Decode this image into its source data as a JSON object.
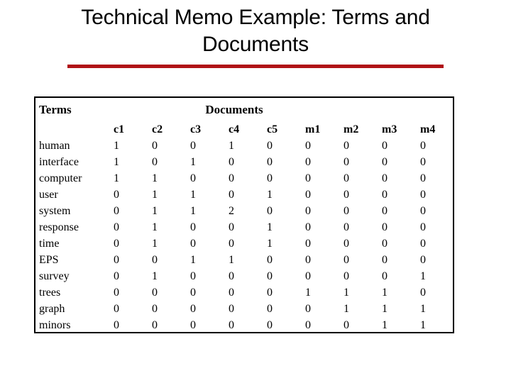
{
  "slide": {
    "title": "Technical Memo Example: Terms and Documents",
    "accent_color": "#b01217",
    "border_color": "#000000",
    "background_color": "#ffffff"
  },
  "table": {
    "section_headers": {
      "terms": "Terms",
      "documents": "Documents"
    },
    "row_label_header": "",
    "columns": [
      "c1",
      "c2",
      "c3",
      "c4",
      "c5",
      "m1",
      "m2",
      "m3",
      "m4"
    ],
    "rows": [
      {
        "term": "human",
        "values": [
          1,
          0,
          0,
          1,
          0,
          0,
          0,
          0,
          0
        ]
      },
      {
        "term": "interface",
        "values": [
          1,
          0,
          1,
          0,
          0,
          0,
          0,
          0,
          0
        ]
      },
      {
        "term": "computer",
        "values": [
          1,
          1,
          0,
          0,
          0,
          0,
          0,
          0,
          0
        ]
      },
      {
        "term": "user",
        "values": [
          0,
          1,
          1,
          0,
          1,
          0,
          0,
          0,
          0
        ]
      },
      {
        "term": "system",
        "values": [
          0,
          1,
          1,
          2,
          0,
          0,
          0,
          0,
          0
        ]
      },
      {
        "term": "response",
        "values": [
          0,
          1,
          0,
          0,
          1,
          0,
          0,
          0,
          0
        ]
      },
      {
        "term": "time",
        "values": [
          0,
          1,
          0,
          0,
          1,
          0,
          0,
          0,
          0
        ]
      },
      {
        "term": "EPS",
        "values": [
          0,
          0,
          1,
          1,
          0,
          0,
          0,
          0,
          0
        ]
      },
      {
        "term": "survey",
        "values": [
          0,
          1,
          0,
          0,
          0,
          0,
          0,
          0,
          1
        ]
      },
      {
        "term": "trees",
        "values": [
          0,
          0,
          0,
          0,
          0,
          1,
          1,
          1,
          0
        ]
      },
      {
        "term": "graph",
        "values": [
          0,
          0,
          0,
          0,
          0,
          0,
          1,
          1,
          1
        ]
      },
      {
        "term": "minors",
        "values": [
          0,
          0,
          0,
          0,
          0,
          0,
          0,
          1,
          1
        ]
      }
    ]
  },
  "chart_data": {
    "type": "table",
    "title": "Technical Memo Example: Terms and Documents",
    "xlabel": "Documents",
    "ylabel": "Terms",
    "categories": [
      "c1",
      "c2",
      "c3",
      "c4",
      "c5",
      "m1",
      "m2",
      "m3",
      "m4"
    ],
    "series": [
      {
        "name": "human",
        "values": [
          1,
          0,
          0,
          1,
          0,
          0,
          0,
          0,
          0
        ]
      },
      {
        "name": "interface",
        "values": [
          1,
          0,
          1,
          0,
          0,
          0,
          0,
          0,
          0
        ]
      },
      {
        "name": "computer",
        "values": [
          1,
          1,
          0,
          0,
          0,
          0,
          0,
          0,
          0
        ]
      },
      {
        "name": "user",
        "values": [
          0,
          1,
          1,
          0,
          1,
          0,
          0,
          0,
          0
        ]
      },
      {
        "name": "system",
        "values": [
          0,
          1,
          1,
          2,
          0,
          0,
          0,
          0,
          0
        ]
      },
      {
        "name": "response",
        "values": [
          0,
          1,
          0,
          0,
          1,
          0,
          0,
          0,
          0
        ]
      },
      {
        "name": "time",
        "values": [
          0,
          1,
          0,
          0,
          1,
          0,
          0,
          0,
          0
        ]
      },
      {
        "name": "EPS",
        "values": [
          0,
          0,
          1,
          1,
          0,
          0,
          0,
          0,
          0
        ]
      },
      {
        "name": "survey",
        "values": [
          0,
          1,
          0,
          0,
          0,
          0,
          0,
          0,
          1
        ]
      },
      {
        "name": "trees",
        "values": [
          0,
          0,
          0,
          0,
          0,
          1,
          1,
          1,
          0
        ]
      },
      {
        "name": "graph",
        "values": [
          0,
          0,
          0,
          0,
          0,
          0,
          1,
          1,
          1
        ]
      },
      {
        "name": "minors",
        "values": [
          0,
          0,
          0,
          0,
          0,
          0,
          0,
          1,
          1
        ]
      }
    ]
  }
}
